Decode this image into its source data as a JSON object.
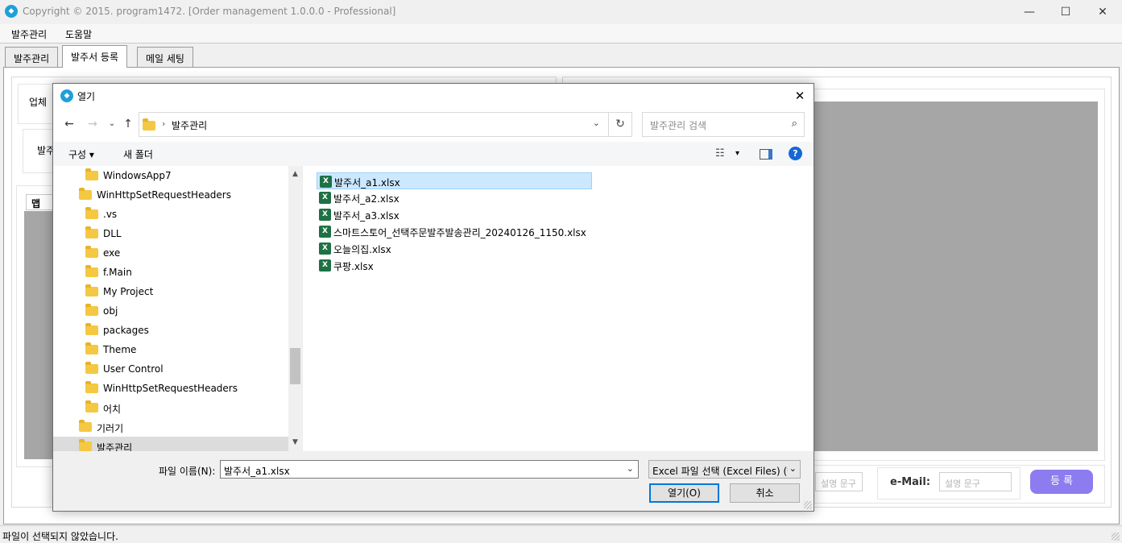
{
  "window": {
    "title": "Copyright © 2015. program1472. [Order management 1.0.0.0 - Professional]",
    "minimize": "—",
    "maximize": "☐",
    "close": "✕"
  },
  "menu": [
    "발주관리",
    "도움말"
  ],
  "tabs": [
    "발주관리",
    "발주서 등록",
    "메일 세팅"
  ],
  "background": {
    "group_label_1": "업체",
    "group_label_2": "발주",
    "grid_header": "맵",
    "email_label": "e-Mail:",
    "desc_placeholder_1": "설명 문구",
    "desc_placeholder_2": "설명 문구",
    "register_button": "등 록"
  },
  "status": {
    "text": "파일이 선택되지 않았습니다."
  },
  "dialog": {
    "title": "열기",
    "close": "✕",
    "address": "발주관리",
    "search_placeholder": "발주관리 검색",
    "toolbar": {
      "organize": "구성 ▾",
      "new_folder": "새 폴더",
      "view_caret": "▾",
      "help": "?"
    },
    "tree": [
      {
        "label": "WindowsApp7",
        "level": 2
      },
      {
        "label": "WinHttpSetRequestHeaders",
        "level": 1
      },
      {
        "label": ".vs",
        "level": 2
      },
      {
        "label": "DLL",
        "level": 2
      },
      {
        "label": "exe",
        "level": 2
      },
      {
        "label": "f.Main",
        "level": 2
      },
      {
        "label": "My Project",
        "level": 2
      },
      {
        "label": "obj",
        "level": 2
      },
      {
        "label": "packages",
        "level": 2
      },
      {
        "label": "Theme",
        "level": 2
      },
      {
        "label": "User Control",
        "level": 2
      },
      {
        "label": "WinHttpSetRequestHeaders",
        "level": 2
      },
      {
        "label": "어치",
        "level": 2
      },
      {
        "label": "기러기",
        "level": 1
      },
      {
        "label": "발주관리",
        "level": 1,
        "selected": true
      }
    ],
    "files": [
      {
        "name": "발주서_a1.xlsx",
        "selected": true
      },
      {
        "name": "발주서_a2.xlsx"
      },
      {
        "name": "발주서_a3.xlsx"
      },
      {
        "name": "스마트스토어_선택주문발주발송관리_20240126_1150.xlsx"
      },
      {
        "name": "오늘의집.xlsx"
      },
      {
        "name": "쿠팡.xlsx"
      }
    ],
    "filename_label": "파일 이름(N):",
    "filename_value": "발주서_a1.xlsx",
    "filter": "Excel 파일 선택 (Excel Files) (*.xlsx)",
    "open_button": "열기(O)",
    "cancel_button": "취소"
  },
  "colors": {
    "accent": "#1f9fd8",
    "register_button": "#8c7cf0",
    "grid_grey": "#a6a6a6",
    "selection": "#cce8ff"
  }
}
